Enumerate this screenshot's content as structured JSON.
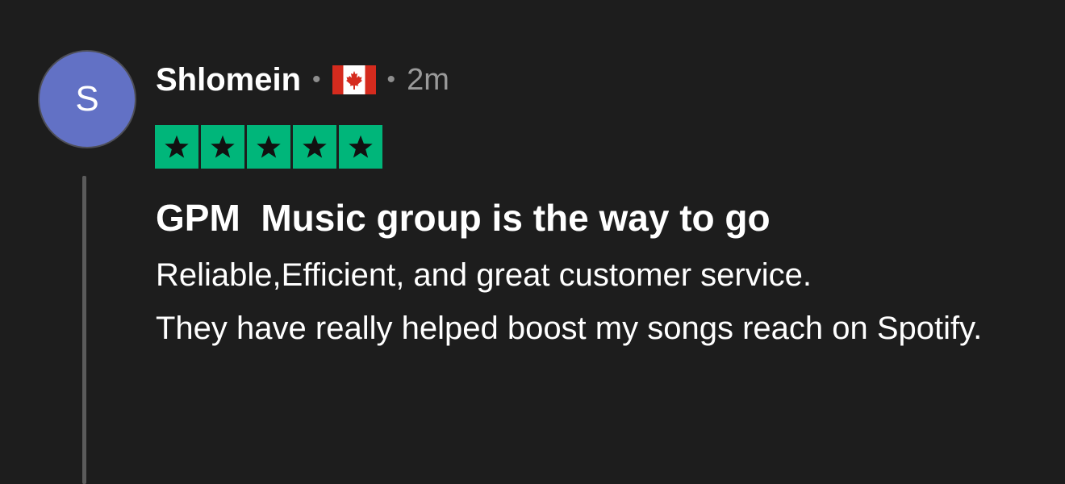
{
  "review": {
    "avatar_initial": "S",
    "username": "Shlomein",
    "separator": "•",
    "country_flag_icon": "canada-flag-icon",
    "time_ago": "2m",
    "rating": 5,
    "rating_max": 5,
    "title": "GPM  Music group is the way to go",
    "body_lines": [
      "Reliable,Efficient, and great customer service.",
      "They have really helped boost my songs reach on Spotify."
    ]
  },
  "colors": {
    "background": "#1d1d1d",
    "avatar": "#6271c5",
    "star_box": "#00b67a",
    "flag_red": "#d52b1e"
  }
}
